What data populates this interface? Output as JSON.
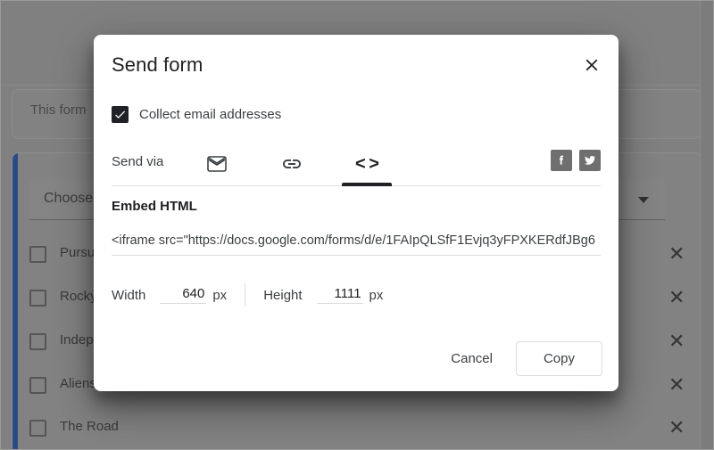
{
  "background": {
    "form_note": "This form",
    "question_title": "Choose",
    "dropdown_icon": "caret-down-icon",
    "remove_icon": "close-x-icon",
    "accent_color": "#2d4a86",
    "options": [
      {
        "label": "Pursu"
      },
      {
        "label": "Rocky"
      },
      {
        "label": "Indep"
      },
      {
        "label": "Aliens"
      },
      {
        "label": "The Road"
      }
    ]
  },
  "dialog": {
    "title": "Send form",
    "close_icon": "close-x-icon",
    "collect_email": {
      "label": "Collect email addresses",
      "checked": true,
      "check_icon": "checkmark-icon"
    },
    "send_via": {
      "label": "Send via",
      "tabs": [
        {
          "id": "email",
          "icon": "envelope-icon",
          "active": false
        },
        {
          "id": "link",
          "icon": "link-chain-icon",
          "active": false
        },
        {
          "id": "embed",
          "icon": "code-brackets-icon",
          "glyph": "< >",
          "active": true
        }
      ],
      "social": [
        {
          "id": "facebook",
          "icon": "facebook-icon",
          "glyph": "f"
        },
        {
          "id": "twitter",
          "icon": "twitter-icon",
          "glyph": "twitter-bird"
        }
      ]
    },
    "embed": {
      "heading": "Embed HTML",
      "value": "<iframe src=\"https://docs.google.com/forms/d/e/1FAIpQLSfF1Evjq3yFPXKERdfJBg6",
      "placeholder": "Embed HTML"
    },
    "dimensions": {
      "width_label": "Width",
      "width_value": "640",
      "width_unit": "px",
      "height_label": "Height",
      "height_value": "1111",
      "height_unit": "px"
    },
    "actions": {
      "cancel_label": "Cancel",
      "copy_label": "Copy"
    }
  }
}
